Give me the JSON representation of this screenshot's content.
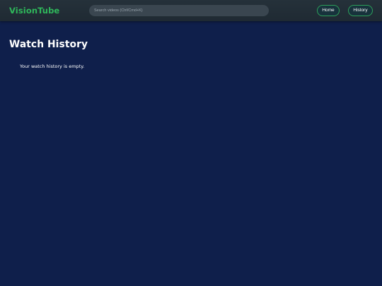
{
  "header": {
    "brand": "VisionTube",
    "search_placeholder": "Search videos (Ctrl/Cmd+K)",
    "search_value": "",
    "nav": {
      "home_label": "Home",
      "history_label": "History"
    }
  },
  "main": {
    "title": "Watch History",
    "empty_message": "Your watch history is empty."
  },
  "colors": {
    "background": "#0f1f4b",
    "header": "#222e37",
    "brand": "#2fb85b",
    "button_border": "#2ea05a",
    "text": "#ffffff"
  }
}
